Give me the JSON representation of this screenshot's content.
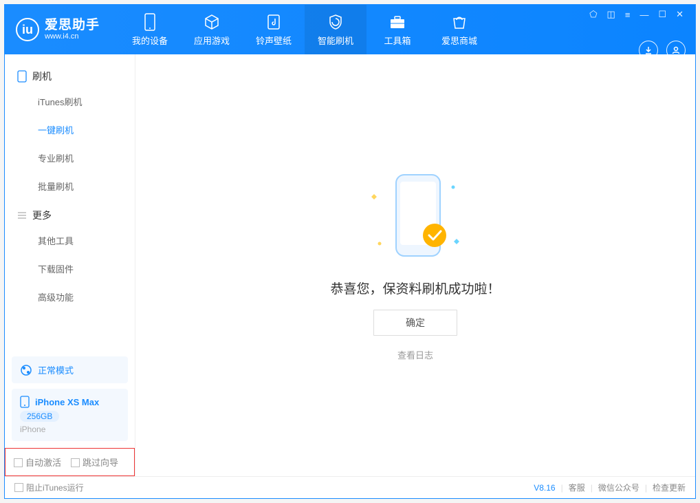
{
  "app": {
    "name": "爱思助手",
    "url": "www.i4.cn",
    "logoLetter": "iu"
  },
  "nav": {
    "items": [
      {
        "label": "我的设备",
        "icon": "device"
      },
      {
        "label": "应用游戏",
        "icon": "cube"
      },
      {
        "label": "铃声壁纸",
        "icon": "music"
      },
      {
        "label": "智能刷机",
        "icon": "shield",
        "active": true
      },
      {
        "label": "工具箱",
        "icon": "toolbox"
      },
      {
        "label": "爱思商城",
        "icon": "store"
      }
    ]
  },
  "winctrl": {
    "config": "⬠",
    "skin": "◫",
    "menu": "≡",
    "min": "—",
    "max": "☐",
    "close": "✕"
  },
  "sidebar": {
    "section1": {
      "title": "刷机",
      "items": [
        "iTunes刷机",
        "一键刷机",
        "专业刷机",
        "批量刷机"
      ],
      "activeIndex": 1
    },
    "section2": {
      "title": "更多",
      "items": [
        "其他工具",
        "下载固件",
        "高级功能"
      ]
    }
  },
  "mode": {
    "label": "正常模式"
  },
  "device": {
    "name": "iPhone XS Max",
    "storage": "256GB",
    "type": "iPhone"
  },
  "options": {
    "opt1": "自动激活",
    "opt2": "跳过向导"
  },
  "main": {
    "title": "恭喜您，保资料刷机成功啦！",
    "ok": "确定",
    "log": "查看日志"
  },
  "status": {
    "blockItunes": "阻止iTunes运行",
    "version": "V8.16",
    "kf": "客服",
    "wx": "微信公众号",
    "update": "检查更新"
  }
}
